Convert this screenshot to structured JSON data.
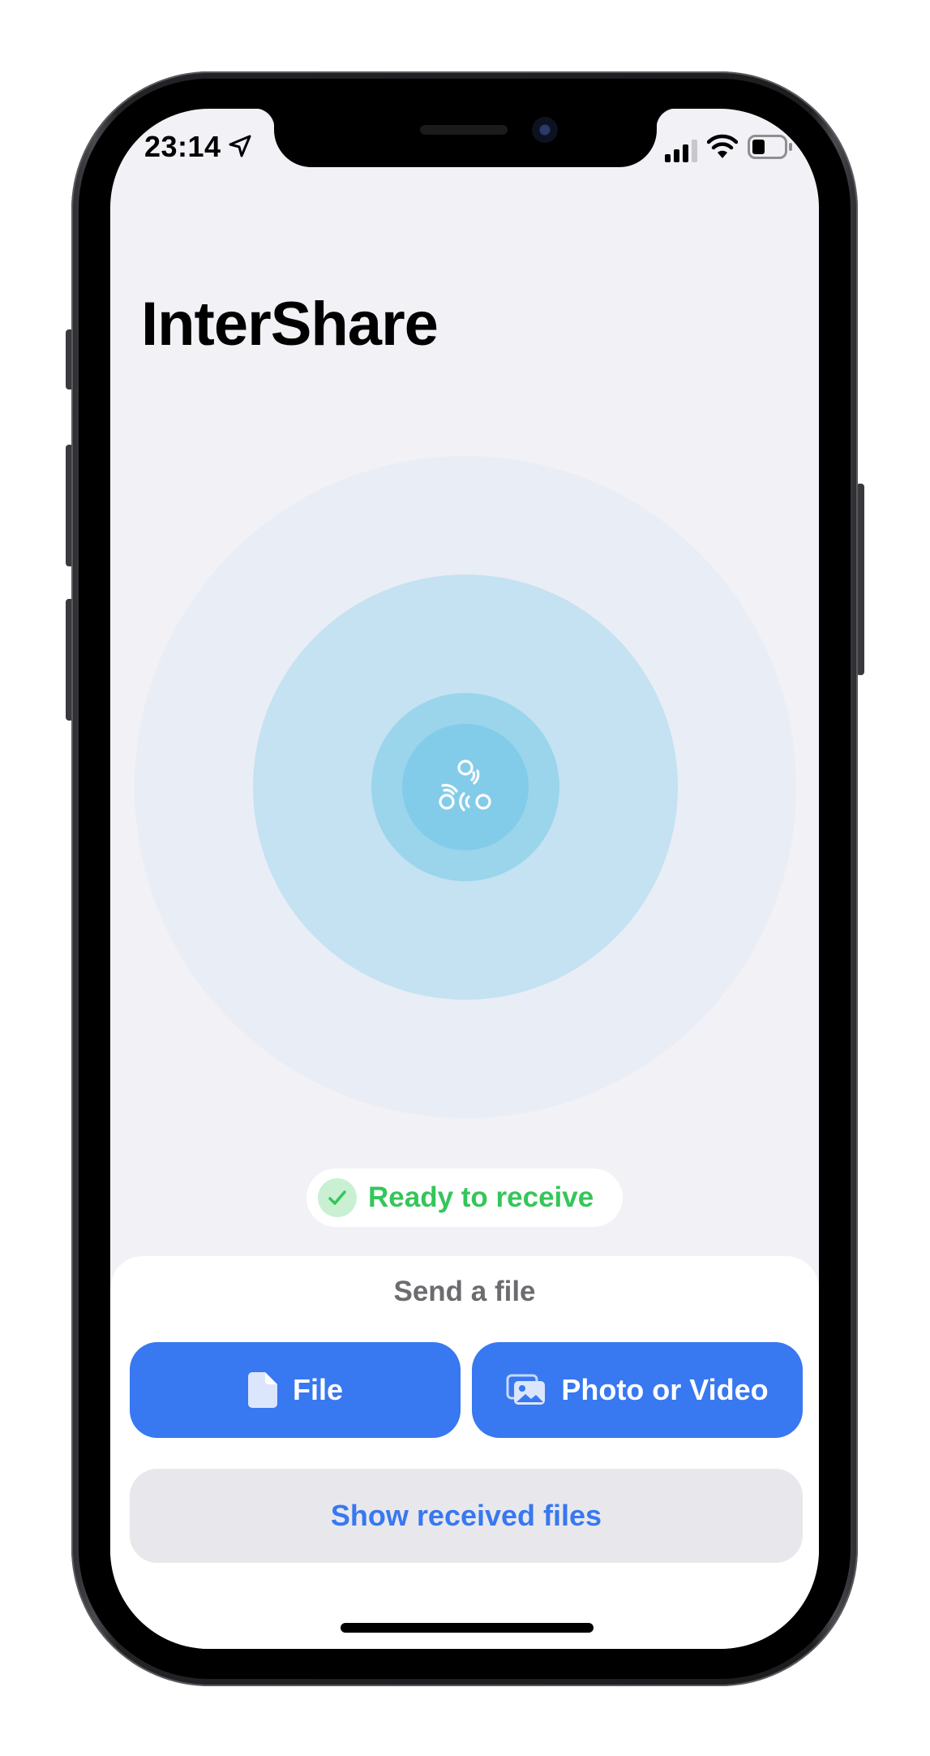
{
  "status_bar": {
    "time": "23:14",
    "icons": [
      "location-arrow-icon",
      "cellular-signal-icon",
      "wifi-icon",
      "battery-icon"
    ]
  },
  "app": {
    "title": "InterShare"
  },
  "radar": {
    "center_icon": "share-devices-icon"
  },
  "receive_status": {
    "text": "Ready to receive",
    "icon": "checkmark-icon",
    "color": "#34c659"
  },
  "send_sheet": {
    "title": "Send a file",
    "file_button": {
      "label": "File",
      "icon": "document-icon"
    },
    "photo_button": {
      "label": "Photo or Video",
      "icon": "photos-icon"
    },
    "received_button": {
      "label": "Show received files"
    }
  },
  "colors": {
    "accent": "#3878f0",
    "success": "#34c659",
    "background": "#f1f1f6"
  }
}
